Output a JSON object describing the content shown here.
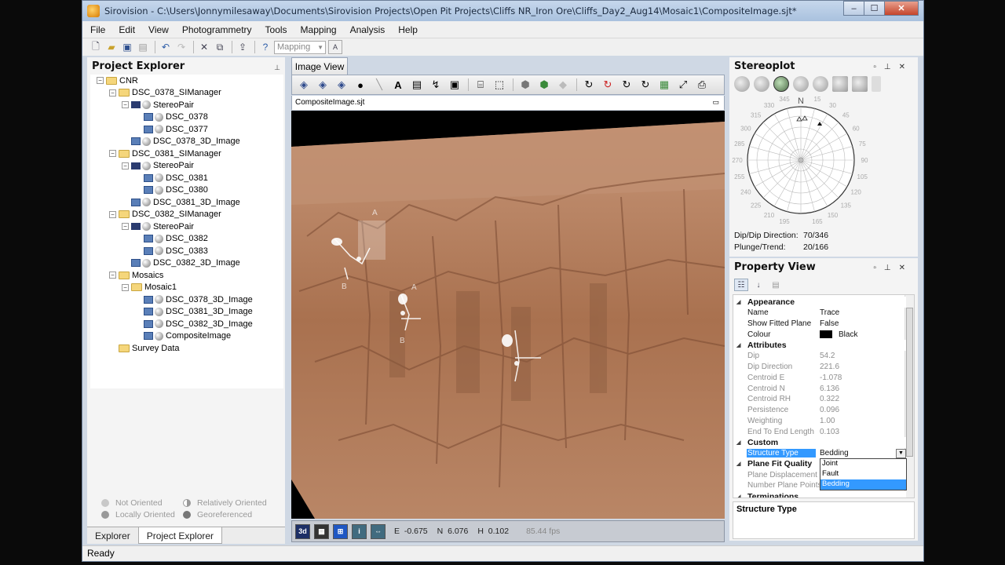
{
  "window": {
    "title": "Sirovision - C:\\Users\\Jonnymilesaway\\Documents\\Sirovision Projects\\Open Pit Projects\\Cliffs NR_Iron Ore\\Cliffs_Day2_Aug14\\Mosaic1\\CompositeImage.sjt*",
    "min": "–",
    "max": "☐",
    "close": "✕"
  },
  "menu": [
    "File",
    "Edit",
    "View",
    "Photogrammetry",
    "Tools",
    "Mapping",
    "Analysis",
    "Help"
  ],
  "toolbar": {
    "mode_combo": "Mapping"
  },
  "explorer": {
    "title": "Project Explorer",
    "tree": [
      {
        "label": "CNR",
        "type": "folder",
        "depth": 0
      },
      {
        "label": "DSC_0378_SIManager",
        "type": "folder",
        "depth": 1
      },
      {
        "label": "StereoPair",
        "type": "pair",
        "depth": 2
      },
      {
        "label": "DSC_0378",
        "type": "image",
        "depth": 3
      },
      {
        "label": "DSC_0377",
        "type": "image",
        "depth": 3
      },
      {
        "label": "DSC_0378_3D_Image",
        "type": "image",
        "depth": 2
      },
      {
        "label": "DSC_0381_SIManager",
        "type": "folder",
        "depth": 1
      },
      {
        "label": "StereoPair",
        "type": "pair",
        "depth": 2
      },
      {
        "label": "DSC_0381",
        "type": "image",
        "depth": 3
      },
      {
        "label": "DSC_0380",
        "type": "image",
        "depth": 3
      },
      {
        "label": "DSC_0381_3D_Image",
        "type": "image",
        "depth": 2
      },
      {
        "label": "DSC_0382_SIManager",
        "type": "folder",
        "depth": 1
      },
      {
        "label": "StereoPair",
        "type": "pair",
        "depth": 2
      },
      {
        "label": "DSC_0382",
        "type": "image",
        "depth": 3
      },
      {
        "label": "DSC_0383",
        "type": "image",
        "depth": 3
      },
      {
        "label": "DSC_0382_3D_Image",
        "type": "image",
        "depth": 2
      },
      {
        "label": "Mosaics",
        "type": "folder",
        "depth": 1
      },
      {
        "label": "Mosaic1",
        "type": "folder",
        "depth": 2
      },
      {
        "label": "DSC_0378_3D_Image",
        "type": "image",
        "depth": 3
      },
      {
        "label": "DSC_0381_3D_Image",
        "type": "image",
        "depth": 3
      },
      {
        "label": "DSC_0382_3D_Image",
        "type": "image",
        "depth": 3
      },
      {
        "label": "CompositeImage",
        "type": "image",
        "depth": 3
      },
      {
        "label": "Survey Data",
        "type": "folder",
        "depth": 1
      }
    ],
    "legend": {
      "not_oriented": "Not Oriented",
      "relatively_oriented": "Relatively Oriented",
      "locally_oriented": "Locally Oriented",
      "georeferenced": "Georeferenced"
    },
    "tabs": [
      "Explorer",
      "Project Explorer"
    ]
  },
  "image_view": {
    "tab": "Image View",
    "doc_title": "CompositeImage.sjt",
    "status": {
      "e_label": "E",
      "e": "-0.675",
      "n_label": "N",
      "n": "6.076",
      "h_label": "H",
      "h": "0.102",
      "fps": "85.44 fps"
    },
    "annotations": [
      "A",
      "B",
      "A",
      "B"
    ]
  },
  "stereoplot": {
    "title": "Stereoplot",
    "north": "N",
    "ticks": [
      "345",
      "15",
      "330",
      "30",
      "315",
      "45",
      "300",
      "60",
      "285",
      "75",
      "270",
      "90",
      "255",
      "105",
      "240",
      "120",
      "225",
      "135",
      "210",
      "150",
      "195",
      "165"
    ],
    "dip_dir_label": "Dip/Dip Direction:",
    "dip_dir": "70/346",
    "plunge_label": "Plunge/Trend:",
    "plunge": "20/166"
  },
  "property_view": {
    "title": "Property View",
    "rows": [
      {
        "kind": "cat",
        "k": "Appearance"
      },
      {
        "kind": "row",
        "k": "Name",
        "v": "Trace"
      },
      {
        "kind": "row",
        "k": "Show Fitted Plane",
        "v": "False"
      },
      {
        "kind": "colour",
        "k": "Colour",
        "v": "Black"
      },
      {
        "kind": "cat",
        "k": "Attributes"
      },
      {
        "kind": "dim",
        "k": "Dip",
        "v": "54.2"
      },
      {
        "kind": "dim",
        "k": "Dip Direction",
        "v": "221.6"
      },
      {
        "kind": "dim",
        "k": "Centroid E",
        "v": "-1.078"
      },
      {
        "kind": "dim",
        "k": "Centroid N",
        "v": "6.136"
      },
      {
        "kind": "dim",
        "k": "Centroid RH",
        "v": "0.322"
      },
      {
        "kind": "dim",
        "k": "Persistence",
        "v": "0.096"
      },
      {
        "kind": "dim",
        "k": "Weighting",
        "v": "1.00"
      },
      {
        "kind": "dim",
        "k": "End To End Length",
        "v": "0.103"
      },
      {
        "kind": "cat",
        "k": "Custom"
      },
      {
        "kind": "sel",
        "k": "Structure Type",
        "v": "Bedding"
      },
      {
        "kind": "cat",
        "k": "Plane Fit Quality"
      },
      {
        "kind": "dim",
        "k": "Plane Displacement",
        "v": ""
      },
      {
        "kind": "dim",
        "k": "Number Plane Points",
        "v": ""
      },
      {
        "kind": "cat",
        "k": "Terminations"
      }
    ],
    "dropdown_options": [
      "Joint",
      "Fault",
      "Bedding"
    ],
    "description": "Structure Type"
  },
  "statusbar": "Ready",
  "colors": {
    "title_bg": "#b5cae4",
    "accent_selection": "#3399ff",
    "rock": "#b07a58"
  }
}
